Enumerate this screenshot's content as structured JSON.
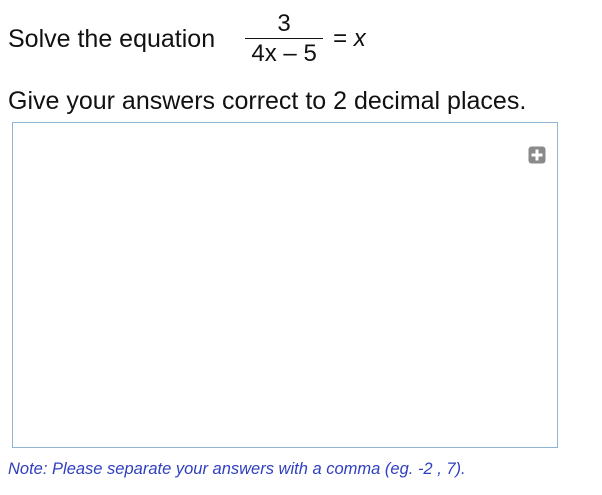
{
  "question": {
    "prompt": "Solve the equation",
    "fraction": {
      "numerator": "3",
      "denominator": "4x – 5"
    },
    "equals": "=",
    "rhs_var": "x"
  },
  "instruction": "Give your answers correct to 2 decimal places.",
  "answer_box": {
    "value": "",
    "expand_icon": "plus-square-icon",
    "border_color": "#8fb4d4"
  },
  "note": {
    "text": "Note: Please separate your answers with a comma (eg. -2 , 7).",
    "color": "#2f3fbf"
  },
  "colors": {
    "text": "#111111",
    "icon_gray": "#8a8a8a"
  }
}
